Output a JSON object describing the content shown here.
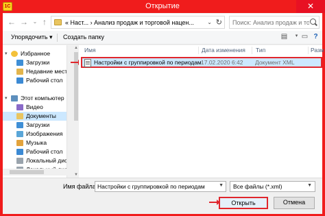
{
  "window": {
    "title": "Открытие",
    "app_icon": "1C",
    "close_label": "✕"
  },
  "address": {
    "crumbs": "«  Наст...  ›  Анализ продаж и торговой нацен...",
    "search_placeholder": "Поиск: Анализ продаж и торг..."
  },
  "toolbar": {
    "organize_label": "Упорядочить ▾",
    "new_folder_label": "Создать папку"
  },
  "sidebar": {
    "items": [
      {
        "label": "Избранное",
        "icon": "star-icon"
      },
      {
        "label": "Загрузки",
        "icon": "downloads-icon"
      },
      {
        "label": "Недавние места",
        "icon": "recent-places-icon"
      },
      {
        "label": "Рабочий стол",
        "icon": "desktop-icon"
      },
      {
        "label": "Этот компьютер",
        "icon": "computer-icon"
      },
      {
        "label": "Видео",
        "icon": "video-icon"
      },
      {
        "label": "Документы",
        "icon": "documents-icon"
      },
      {
        "label": "Загрузки",
        "icon": "downloads-icon"
      },
      {
        "label": "Изображения",
        "icon": "pictures-icon"
      },
      {
        "label": "Музыка",
        "icon": "music-icon"
      },
      {
        "label": "Рабочий стол",
        "icon": "desktop-icon"
      },
      {
        "label": "Локальный диск",
        "icon": "drive-icon"
      },
      {
        "label": "Локальный диск",
        "icon": "drive-icon"
      }
    ]
  },
  "filelist": {
    "columns": [
      "Имя",
      "Дата изменения",
      "Тип",
      "Разм"
    ],
    "rows": [
      {
        "name": "Настройки с группировкой по периодам",
        "date": "17.02.2020 6:42",
        "type": "Документ XML"
      }
    ]
  },
  "footer": {
    "filename_label": "Имя файла:",
    "filename_value": "Настройки с группировкой по периодам",
    "filter_value": "Все файлы (*.xml)",
    "open_label": "Открыть",
    "cancel_label": "Отмена"
  },
  "colors": {
    "titlebar": "#f01c1c",
    "selection": "#cce8ff",
    "highlight": "#e0262c"
  }
}
